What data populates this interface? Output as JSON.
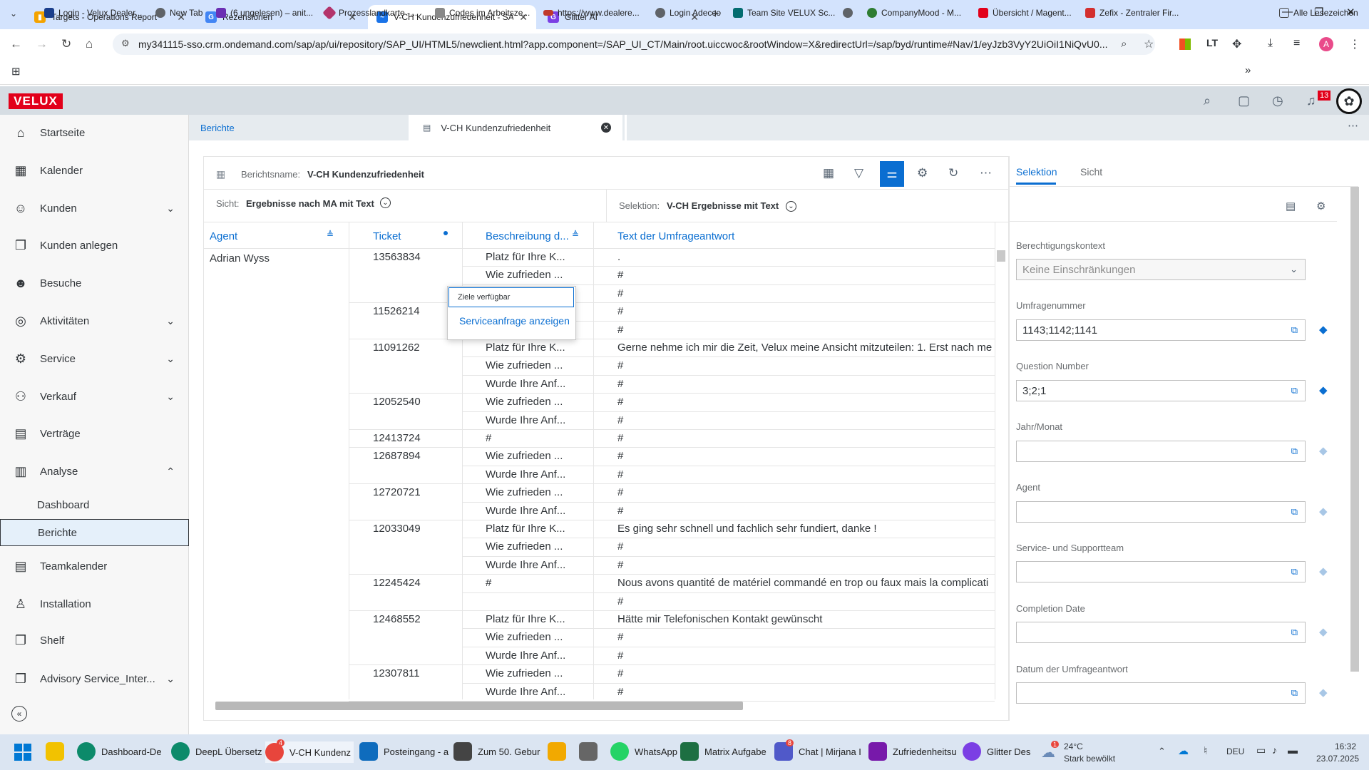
{
  "browser": {
    "tabs": [
      {
        "title": "Targets - Operations Report",
        "fav_color": "#f4a300"
      },
      {
        "title": "Rezensionen",
        "fav_color": "#4285f4"
      },
      {
        "title": "V-CH Kundenzufriedenheit - SA",
        "fav_color": "#1a73e8"
      },
      {
        "title": "Glitter AI",
        "fav_color": "#7b3fe4"
      }
    ],
    "new_tab": "+",
    "url": "my341115-sso.crm.ondemand.com/sap/ap/ui/repository/SAP_UI/HTML5/newclient.html?app.component=/SAP_UI_CT/Main/root.uiccwoc&rootWindow=X&redirectUrl=/sap/byd/runtime#Nav/1/eyJzb3VyY2UiOiI1NiQvU0...",
    "profile_initial": "A",
    "bookmarks": [
      {
        "label": "Login - Velux Dealer...",
        "color": "#1a3e8c"
      },
      {
        "label": "New Tab",
        "color": "#5f6368"
      },
      {
        "label": "(6 ungelesen) – anit...",
        "color": "#6b2fb3"
      },
      {
        "label": "Prozesslandkarte -...",
        "color": "#b3346b"
      },
      {
        "label": "Codes im Arbeitsze...",
        "color": "#888888"
      },
      {
        "label": "https://www.dealere...",
        "color": "#c0392b"
      },
      {
        "label": "Login Adecco",
        "color": "#5f6368"
      },
      {
        "label": "Team Site VELUX Sc...",
        "color": "#036c70"
      },
      {
        "label": "",
        "color": "#5f6368"
      },
      {
        "label": "CompanyMood - M...",
        "color": "#2e7d32"
      },
      {
        "label": "Übersicht / Magent...",
        "color": "#e2001a"
      },
      {
        "label": "Zefix - Zentraler Fir...",
        "color": "#d32f2f"
      }
    ],
    "all_bookmarks": "Alle Lesezeichen"
  },
  "shell": {
    "logo": "VELUX",
    "notification_count": "13"
  },
  "sidebar": {
    "items": [
      {
        "label": "Startseite",
        "icon": "home-icon",
        "glyph": "⌂"
      },
      {
        "label": "Kalender",
        "icon": "calendar-icon",
        "glyph": "▦"
      },
      {
        "label": "Kunden",
        "icon": "customers-icon",
        "glyph": "☺"
      },
      {
        "label": "Kunden anlegen",
        "icon": "create-customer-icon",
        "glyph": "❐"
      },
      {
        "label": "Besuche",
        "icon": "visits-icon",
        "glyph": "☻"
      },
      {
        "label": "Aktivitäten",
        "icon": "activities-icon",
        "glyph": "◎"
      },
      {
        "label": "Service",
        "icon": "service-icon",
        "glyph": "⚙"
      },
      {
        "label": "Verkauf",
        "icon": "sales-icon",
        "glyph": "⚇"
      },
      {
        "label": "Verträge",
        "icon": "contracts-icon",
        "glyph": "▤"
      },
      {
        "label": "Analyse",
        "icon": "analysis-icon",
        "glyph": "▥"
      }
    ],
    "sub_items": [
      {
        "label": "Dashboard"
      },
      {
        "label": "Berichte"
      }
    ],
    "items_after": [
      {
        "label": "Teamkalender",
        "icon": "team-calendar-icon",
        "glyph": "▤"
      },
      {
        "label": "Installation",
        "icon": "installation-icon",
        "glyph": "♙"
      },
      {
        "label": "Shelf",
        "icon": "shelf-icon",
        "glyph": "❐"
      },
      {
        "label": "Advisory Service_Inter...",
        "icon": "advisory-icon",
        "glyph": "❐"
      }
    ]
  },
  "content_tabs": {
    "berichte": "Berichte",
    "report": "V-CH Kundenzufriedenheit"
  },
  "report": {
    "name_label": "Berichtsname:",
    "name_value": "V-CH Kundenzufriedenheit",
    "view_label": "Sicht:",
    "view_value": "Ergebnisse nach MA mit Text",
    "selection_label": "Selektion:",
    "selection_value": "V-CH Ergebnisse mit Text"
  },
  "table": {
    "headers": [
      "Agent",
      "Ticket",
      "Beschreibung d...",
      "Text der Umfrageantwort"
    ],
    "agent": "Adrian Wyss",
    "rows": [
      {
        "ticket": "13563834",
        "desc": "Platz für Ihre K...",
        "text": "."
      },
      {
        "ticket": "",
        "desc": "Wie zufrieden ...",
        "text": "#"
      },
      {
        "ticket": "",
        "desc": "",
        "text": "#"
      },
      {
        "ticket": "11526214",
        "desc": "",
        "text": "#"
      },
      {
        "ticket": "",
        "desc": "",
        "text": "#"
      },
      {
        "ticket": "11091262",
        "desc": "Platz für Ihre K...",
        "text": "Gerne nehme ich mir die Zeit, Velux meine Ansicht mitzuteilen: 1. Erst nach me"
      },
      {
        "ticket": "",
        "desc": "Wie zufrieden ...",
        "text": "#"
      },
      {
        "ticket": "",
        "desc": "Wurde Ihre Anf...",
        "text": "#"
      },
      {
        "ticket": "12052540",
        "desc": "Wie zufrieden ...",
        "text": "#"
      },
      {
        "ticket": "",
        "desc": "Wurde Ihre Anf...",
        "text": "#"
      },
      {
        "ticket": "12413724",
        "desc": "#",
        "text": "#"
      },
      {
        "ticket": "12687894",
        "desc": "Wie zufrieden ...",
        "text": "#"
      },
      {
        "ticket": "",
        "desc": "Wurde Ihre Anf...",
        "text": "#"
      },
      {
        "ticket": "12720721",
        "desc": "Wie zufrieden ...",
        "text": "#"
      },
      {
        "ticket": "",
        "desc": "Wurde Ihre Anf...",
        "text": "#"
      },
      {
        "ticket": "12033049",
        "desc": "Platz für Ihre K...",
        "text": "Es ging sehr schnell und fachlich sehr fundiert, danke !"
      },
      {
        "ticket": "",
        "desc": "Wie zufrieden ...",
        "text": "#"
      },
      {
        "ticket": "",
        "desc": "Wurde Ihre Anf...",
        "text": "#"
      },
      {
        "ticket": "12245424",
        "desc": "#",
        "text": "Nous avons quantité de matériel commandé en trop ou faux mais la complicati"
      },
      {
        "ticket": "",
        "desc": "",
        "text": "#"
      },
      {
        "ticket": "12468552",
        "desc": "Platz für Ihre K...",
        "text": "Hätte mir Telefonischen Kontakt gewünscht"
      },
      {
        "ticket": "",
        "desc": "Wie zufrieden ...",
        "text": "#"
      },
      {
        "ticket": "",
        "desc": "Wurde Ihre Anf...",
        "text": "#"
      },
      {
        "ticket": "12307811",
        "desc": "Wie zufrieden ...",
        "text": "#"
      },
      {
        "ticket": "",
        "desc": "Wurde Ihre Anf...",
        "text": "#"
      }
    ]
  },
  "popover": {
    "title": "Ziele verfügbar",
    "action": "Serviceanfrage anzeigen"
  },
  "right_panel": {
    "tabs": [
      "Selektion",
      "Sicht"
    ],
    "fields": [
      {
        "label": "Berechtigungskontext",
        "value": "",
        "placeholder": "Keine Einschränkungen",
        "type": "select"
      },
      {
        "label": "Umfragenummer",
        "value": "1143;1142;1141"
      },
      {
        "label": "Question Number",
        "value": "3;2;1"
      },
      {
        "label": "Jahr/Monat",
        "value": ""
      },
      {
        "label": "Agent",
        "value": ""
      },
      {
        "label": "Service- und Supportteam",
        "value": ""
      },
      {
        "label": "Completion Date",
        "value": ""
      },
      {
        "label": "Datum der Umfrageantwort",
        "value": ""
      }
    ]
  },
  "taskbar": {
    "apps": [
      {
        "label": "",
        "color": "#0078d4"
      },
      {
        "label": "",
        "color": "#f2c200"
      },
      {
        "label": "Dashboard-De",
        "color": "#0c8a6a"
      },
      {
        "label": "DeepL Übersetz",
        "color": "#0c8a6a"
      },
      {
        "label": "V-CH Kundenz",
        "color": "#e8453c"
      },
      {
        "label": "Posteingang - a",
        "color": "#0f6cbd"
      },
      {
        "label": "Zum 50. Gebur",
        "color": "#444444"
      },
      {
        "label": "",
        "color": "#f2a900"
      },
      {
        "label": "",
        "color": "#666666"
      },
      {
        "label": "WhatsApp",
        "color": "#25d366"
      },
      {
        "label": "Matrix Aufgabe",
        "color": "#1d6f42"
      },
      {
        "label": "Chat | Mirjana I",
        "color": "#5059c9"
      },
      {
        "label": "Zufriedenheitsu",
        "color": "#7719aa"
      },
      {
        "label": "Glitter Des",
        "color": "#7b3fe4"
      }
    ],
    "chrome_badge": "4",
    "teams_badge": "8",
    "weather_temp": "24°C",
    "weather_text": "Stark bewölkt",
    "weather_badge": "1",
    "lang": "DEU",
    "time": "16:32",
    "date": "23.07.2025"
  }
}
